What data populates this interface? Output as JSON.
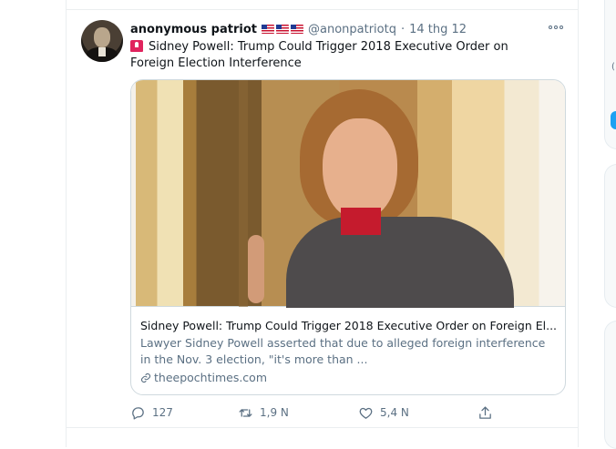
{
  "tweet": {
    "display_name": "anonymous patriot",
    "flags": [
      "us-flag",
      "us-flag",
      "us-flag"
    ],
    "handle": "@anonpatriotq",
    "separator": "·",
    "date": "14 thg 12",
    "text": "Sidney Powell: Trump Could Trigger 2018 Executive Order on Foreign Election Interference",
    "text_icon": "siren-icon",
    "card": {
      "title": "Sidney Powell: Trump Could Trigger 2018 Executive Order on Foreign El...",
      "description": "Lawyer Sidney Powell asserted that due to alleged foreign interference in the Nov. 3 election, \"it's more than ...",
      "domain": "theepochtimes.com"
    },
    "actions": {
      "reply_count": "127",
      "retweet_count": "1,9 N",
      "like_count": "5,4 N"
    }
  },
  "sidebar": {
    "glyph": "("
  },
  "colors": {
    "secondary_text": "#5b7083",
    "border": "#cfd9de",
    "accent": "#1da1f2"
  }
}
